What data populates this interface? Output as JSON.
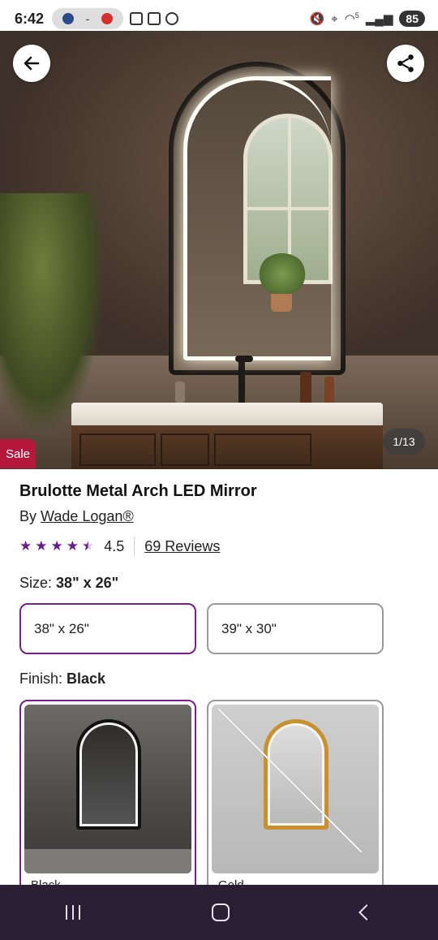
{
  "status_bar": {
    "time": "6:42",
    "pill_text": "-",
    "battery": "85",
    "signal_label": "5"
  },
  "hero": {
    "image_counter": "1/13",
    "sale_badge": "Sale"
  },
  "product": {
    "title": "Brulotte Metal Arch LED Mirror",
    "by_prefix": "By",
    "brand": "Wade Logan®",
    "rating": {
      "stars": 4.5,
      "value_text": "4.5",
      "reviews_link": "69 Reviews"
    }
  },
  "size": {
    "label": "Size:",
    "selected": "38\" x 26\"",
    "options": [
      {
        "label": "38\" x 26\"",
        "selected": true
      },
      {
        "label": "39\" x 30\"",
        "selected": false
      }
    ]
  },
  "finish": {
    "label": "Finish:",
    "selected": "Black",
    "options": [
      {
        "name": "Black",
        "selected": true,
        "available": true
      },
      {
        "name": "Gold",
        "selected": false,
        "available": false
      }
    ]
  },
  "colors": {
    "accent": "#7b1d8c",
    "star": "#6b1c8c",
    "sale": "#b5173d",
    "nav_bar": "#2b1f35"
  },
  "icons": {
    "back": "arrow-left-icon",
    "share": "share-icon",
    "nav_recents": "recents-icon",
    "nav_home": "home-icon",
    "nav_back": "chevron-left-icon"
  }
}
